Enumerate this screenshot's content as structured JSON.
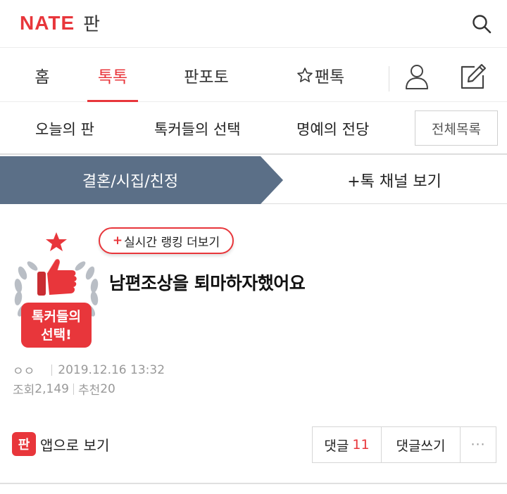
{
  "header": {
    "logo_nate": "NATE",
    "logo_pan": "판",
    "search_icon": "search-icon"
  },
  "main_nav": {
    "items": [
      {
        "label": "홈",
        "active": false
      },
      {
        "label": "톡톡",
        "active": true
      },
      {
        "label": "판포토",
        "active": false
      },
      {
        "label": "팬톡",
        "active": false,
        "icon": "star-outline-icon"
      }
    ],
    "icons": [
      "user-icon",
      "edit-icon"
    ]
  },
  "sub_nav": {
    "items": [
      "오늘의 판",
      "톡커들의 선택",
      "명예의 전당"
    ],
    "all_list": "전체목록"
  },
  "channel": {
    "current": "결혼/시집/친정",
    "more": "+톡 채널 보기",
    "color": "#5b6f87"
  },
  "post": {
    "badge_text_line1": "톡커들의",
    "badge_text_line2": "선택!",
    "ranking_plus": "+",
    "ranking_label": "실시간 랭킹 더보기",
    "title": "남편조상을 퇴마하자했어요",
    "author": "ㅇㅇ",
    "date": "2019.12.16 13:32",
    "views_label": "조회",
    "views": "2,149",
    "recommend_label": "추천",
    "recommend": "20"
  },
  "actions": {
    "app_icon_text": "판",
    "app_view": "앱으로 보기",
    "comments_label": "댓글",
    "comments_count": "11",
    "write_comment": "댓글쓰기",
    "more": "···"
  },
  "colors": {
    "accent": "#e8363b",
    "channel_bg": "#5b6f87"
  }
}
